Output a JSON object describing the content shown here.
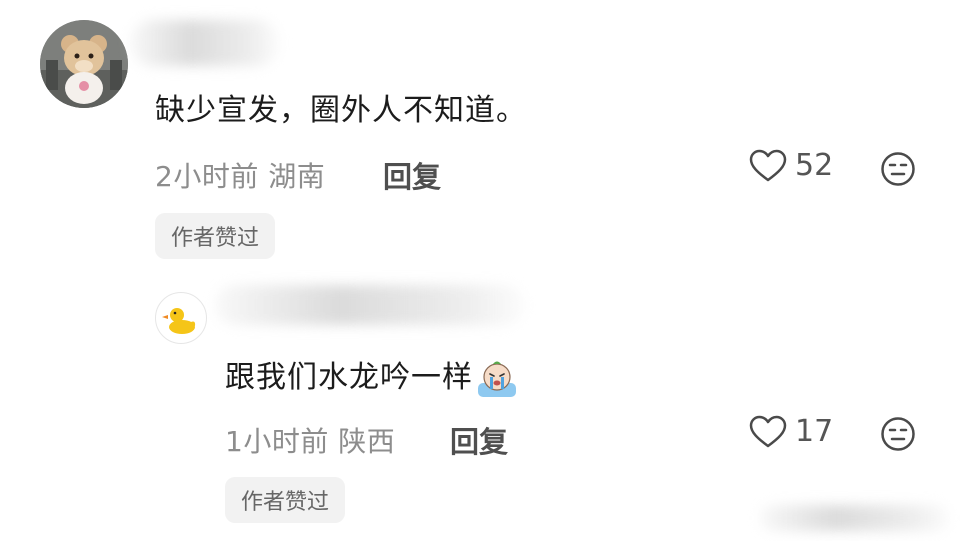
{
  "comments": [
    {
      "text": "缺少宣发，圈外人不知道。",
      "time": "2小时前",
      "location": "湖南",
      "reply_label": "回复",
      "likes": "52",
      "badge": "作者赞过",
      "avatar_icon": "bear-avatar-icon"
    },
    {
      "text": "跟我们水龙吟一样",
      "time": "1小时前",
      "location": "陕西",
      "reply_label": "回复",
      "likes": "17",
      "badge": "作者赞过",
      "avatar_icon": "duck-avatar-icon",
      "inline_emoji": "crying-emoji-icon"
    }
  ],
  "colors": {
    "text": "#1c1c1c",
    "meta": "#8d8d8d",
    "badge_bg": "#f2f2f2",
    "icon": "#4a4a4a",
    "duck": "#f5c518"
  }
}
